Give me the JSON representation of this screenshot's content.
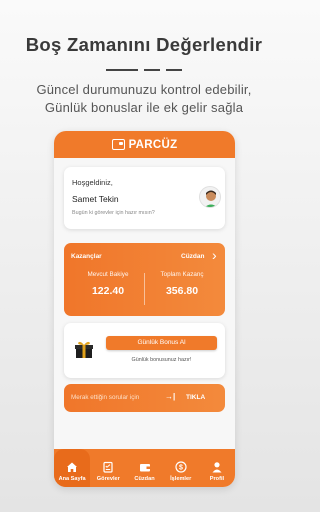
{
  "promo": {
    "headline": "Boş Zamanını Değerlendir",
    "sub_line1": "Güncel durumunuzu kontrol edebilir,",
    "sub_line2": "Günlük bonuslar ile ek gelir sağla"
  },
  "app": {
    "brand": "PARCÜZ",
    "welcome": {
      "greeting": "Hoşgeldiniz,",
      "user_name": "Samet Tekin",
      "question": "Bugün ki görevler için hazır mısın?"
    },
    "earnings": {
      "title": "Kazançlar",
      "wallet_link": "Cüzdan",
      "current_balance_label": "Mevcut Bakiye",
      "current_balance": "122.40",
      "total_earnings_label": "Toplam Kazanç",
      "total_earnings": "356.80"
    },
    "bonus": {
      "button_label": "Günlük Bonus Al",
      "status": "Günlük bonusunuz hazır!"
    },
    "ask": {
      "text": "Merak ettiğin sorular için",
      "arrow": "→|",
      "action": "TIKLA"
    },
    "tabs": [
      {
        "label": "Ana Sayfa",
        "icon": "home-icon",
        "active": true
      },
      {
        "label": "Görevler",
        "icon": "tasks-icon",
        "active": false
      },
      {
        "label": "Cüzdan",
        "icon": "wallet-icon",
        "active": false
      },
      {
        "label": "İşlemler",
        "icon": "transactions-icon",
        "active": false
      },
      {
        "label": "Profil",
        "icon": "profile-icon",
        "active": false
      }
    ],
    "colors": {
      "accent": "#f07a2a",
      "accent_dark": "#e86b1b"
    }
  }
}
